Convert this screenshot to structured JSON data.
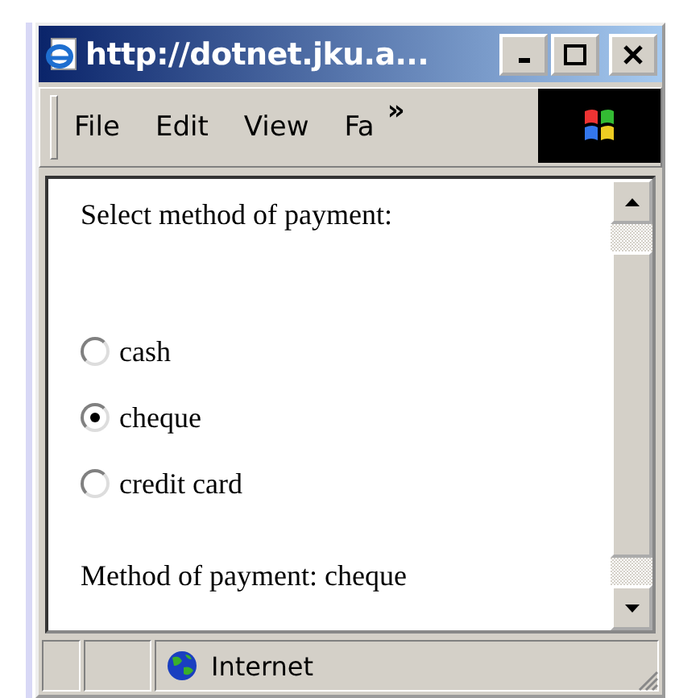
{
  "window": {
    "title": "http://dotnet.jku.a..."
  },
  "menu": [
    {
      "label": "File"
    },
    {
      "label": "Edit"
    },
    {
      "label": "View"
    },
    {
      "label": "Fa"
    }
  ],
  "menu_overflow": "»",
  "page": {
    "prompt": "Select method of payment:",
    "options": [
      {
        "label": "cash",
        "selected": false
      },
      {
        "label": "cheque",
        "selected": true
      },
      {
        "label": "credit card",
        "selected": false
      }
    ],
    "result": "Method of payment: cheque"
  },
  "status_bar": {
    "zone": "Internet"
  }
}
